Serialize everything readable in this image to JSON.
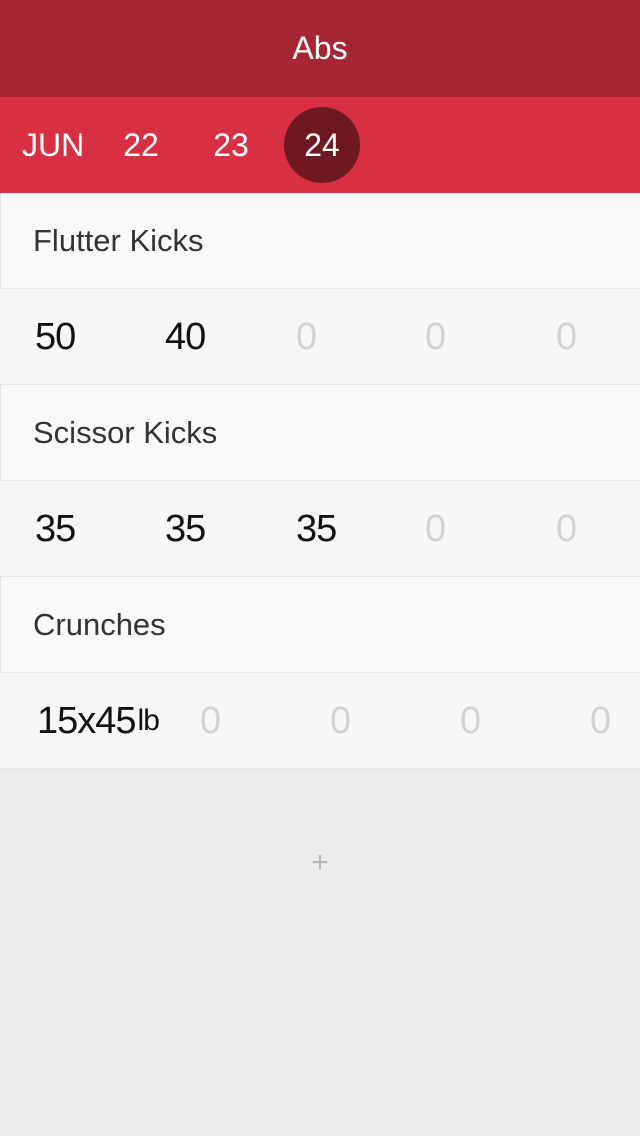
{
  "header": {
    "title": "Abs"
  },
  "dates": {
    "month": "JUN",
    "days": [
      "22",
      "23",
      "24"
    ],
    "selected": "24"
  },
  "exercises": [
    {
      "name": "Flutter Kicks",
      "sets": [
        "50",
        "40",
        "0",
        "0",
        "0"
      ]
    },
    {
      "name": "Scissor Kicks",
      "sets": [
        "35",
        "35",
        "35",
        "0",
        "0"
      ]
    },
    {
      "name": "Crunches",
      "first_set": {
        "value": "15x45",
        "unit": "lb"
      },
      "sets": [
        "0",
        "0",
        "0",
        "0"
      ]
    }
  ],
  "add": {
    "label": "+"
  },
  "colors": {
    "nav_bar": "#a72634",
    "date_bar": "#d82f42",
    "selected_day": "#6e1820",
    "empty_value": "#cfd3d3"
  }
}
